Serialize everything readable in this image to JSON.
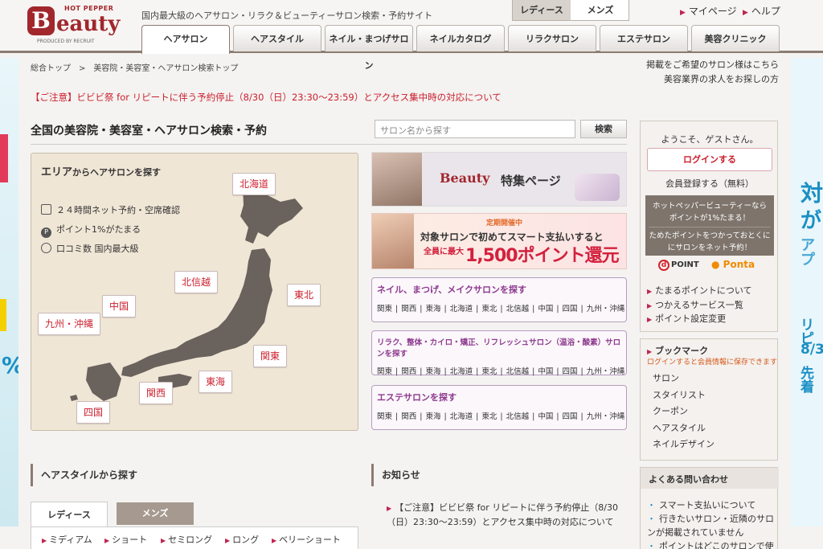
{
  "header": {
    "logo_top": "HOT PEPPER",
    "logo_b": "B",
    "logo_rest": "eauty",
    "logo_produced": "PRODUCED BY RECRUIT",
    "tagline": "国内最大級のヘアサロン・リラク＆ビューティーサロン検索・予約サイト",
    "gender_ladies": "レディース",
    "gender_mens": "メンズ",
    "mypage": "マイページ",
    "help": "ヘルプ",
    "tabs": [
      "ヘアサロン",
      "ヘアスタイル",
      "ネイル・まつげサロン",
      "ネイルカタログ",
      "リラクサロン",
      "エステサロン",
      "美容クリニック"
    ]
  },
  "breadcrumb": "総合トップ　>　美容院・美容室・ヘアサロン検索トップ",
  "right_info": [
    "掲載をご希望のサロン様はこちら",
    "美容業界の求人をお探しの方"
  ],
  "notice": "【ご注意】ビビビ祭 for リピートに伴う予約停止（8/30（日）23:30～23:59）とアクセス集中時の対応について",
  "search": {
    "heading": "全国の美容院・美容室・ヘアサロン検索・予約",
    "placeholder": "サロン名から探す",
    "button": "検索"
  },
  "area": {
    "title_bold": "エリア",
    "title_rest": "からヘアサロンを探す",
    "features": [
      "２４時間ネット予約・空席確認",
      "ポイント1%がたまる",
      "口コミ数 国内最大級"
    ],
    "regions": [
      "北海道",
      "東北",
      "関東",
      "北信越",
      "東海",
      "関西",
      "中国",
      "四国",
      "九州・沖縄"
    ]
  },
  "banners": {
    "special_logo": "Beauty",
    "special_text": "特集ページ",
    "promo_tag": "定期開催中",
    "promo_line1": "対象サロンで初めてスマート支払いすると",
    "promo_line2": "全員に最大",
    "promo_line3": "1,500ポイント還元"
  },
  "categories": [
    {
      "title": "ネイル、まつげ、メイクサロンを探す",
      "links": [
        "関東",
        "関西",
        "東海",
        "北海道",
        "東北",
        "北信越",
        "中国",
        "四国",
        "九州・沖縄"
      ]
    },
    {
      "title": "リラク、整体・カイロ・矯正、リフレッシュサロン（温浴・酸素）サロンを探す",
      "links": [
        "関東",
        "関西",
        "東海",
        "北海道",
        "東北",
        "北信越",
        "中国",
        "四国",
        "九州・沖縄"
      ]
    },
    {
      "title": "エステサロンを探す",
      "links": [
        "関東",
        "関西",
        "東海",
        "北海道",
        "東北",
        "北信越",
        "中国",
        "四国",
        "九州・沖縄"
      ]
    }
  ],
  "sidebar": {
    "welcome": "ようこそ、ゲストさん。",
    "login": "ログインする",
    "register": "会員登録する（無料）",
    "point_line1": "ホットペッパービューティーなら",
    "point_line2": "ポイントが1%たまる！",
    "point_line3": "ためたポイントをつかっておとくに",
    "point_line4": "にサロンをネット予約！",
    "dpoint": "POINT",
    "ponta": "Ponta",
    "links": [
      "たまるポイントについて",
      "つかえるサービス一覧",
      "ポイント設定変更"
    ],
    "bookmark_title": "ブックマーク",
    "bookmark_note": "ログインすると会員情報に保存できます",
    "bookmark_items": [
      "サロン",
      "スタイリスト",
      "クーポン",
      "ヘアスタイル",
      "ネイルデザイン"
    ],
    "faq_title": "よくある問い合わせ",
    "faq_items": [
      "スマート支払いについて",
      "行きたいサロン・近隣のサロンが掲載されていません",
      "ポイントはどこのサロンで使"
    ]
  },
  "hairstyle": {
    "heading": "ヘアスタイルから探す",
    "tab_ladies": "レディース",
    "tab_mens": "メンズ",
    "lengths": [
      "ミディアム",
      "ショート",
      "セミロング",
      "ロング",
      "ベリーショート"
    ]
  },
  "news": {
    "heading": "お知らせ",
    "item": "【ご注意】ビビビ祭 for リピートに伴う予約停止（8/30（日）23:30～23:59）とアクセス集中時の対応について"
  },
  "side_ads": {
    "left_text": "%",
    "right_lines": [
      "対",
      "が",
      "アプ",
      "リピ",
      "8/3",
      "先着"
    ]
  },
  "colors": {
    "brand": "#a1272d",
    "notice": "#cc1f2e",
    "purple": "#8d3a8e"
  }
}
